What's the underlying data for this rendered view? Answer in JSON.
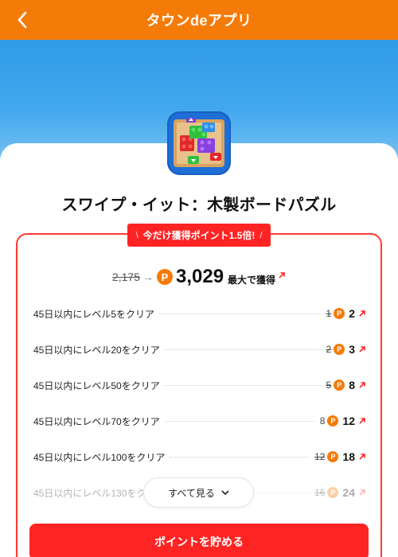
{
  "header": {
    "title": "タウンdeアプリ",
    "back_icon": "chevron-left-icon"
  },
  "app": {
    "name": "スワイプ・イット：木製ボードパズル",
    "icon": "block-puzzle-app-icon"
  },
  "promo": {
    "slash_left": "\\",
    "text": "今だけ獲得ポイント1.5倍!",
    "slash_right": "/"
  },
  "total": {
    "old": "2,175",
    "arrow": "→",
    "coin": "P",
    "new": "3,029",
    "max_label": "最大で獲得"
  },
  "tasks": [
    {
      "label": "45日以内にレベル5をクリア",
      "old": "1",
      "new": "2"
    },
    {
      "label": "45日以内にレベル20をクリア",
      "old": "2",
      "new": "3"
    },
    {
      "label": "45日以内にレベル50をクリア",
      "old": "5",
      "new": "8"
    },
    {
      "label": "45日以内にレベル70をクリア",
      "old": "8",
      "new": "12"
    },
    {
      "label": "45日以内にレベル100をクリア",
      "old": "12",
      "new": "18"
    },
    {
      "label": "45日以内にレベル130をク",
      "old": "16",
      "new": "24"
    }
  ],
  "see_all": {
    "label": "すべて見る"
  },
  "cta": {
    "label": "ポイントを貯める"
  },
  "colors": {
    "header": "#f57b08",
    "accent_red": "#ff2424",
    "coin": "#f57b08"
  }
}
